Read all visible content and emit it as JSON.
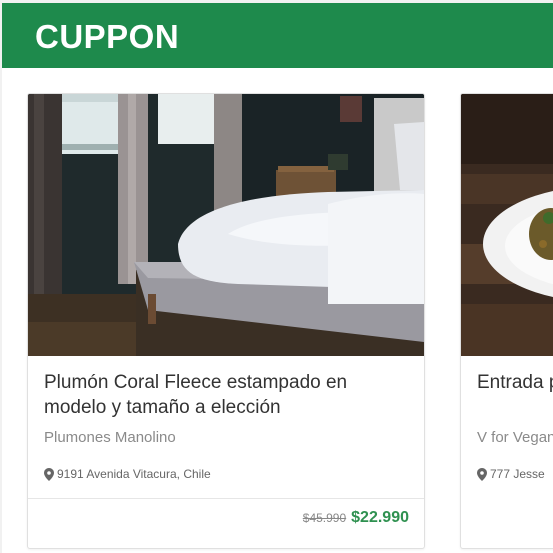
{
  "app": {
    "brand": "CUPPON"
  },
  "colors": {
    "brand_green": "#1e8a4c",
    "price_green": "#2f9150"
  },
  "deals": [
    {
      "title": "Plumón Coral Fleece estampado en modelo y tamaño a elección",
      "merchant": "Plumones Manolino",
      "location": "9191 Avenida Vitacura, Chile",
      "old_price": "$45.990",
      "new_price": "$22.990",
      "image": "bedroom-photo"
    },
    {
      "title": "Entrada p + postres",
      "merchant": "V for Vegan",
      "location": "777 Jesse",
      "image": "food-photo"
    }
  ],
  "icons": {
    "location": "map-pin-icon"
  }
}
